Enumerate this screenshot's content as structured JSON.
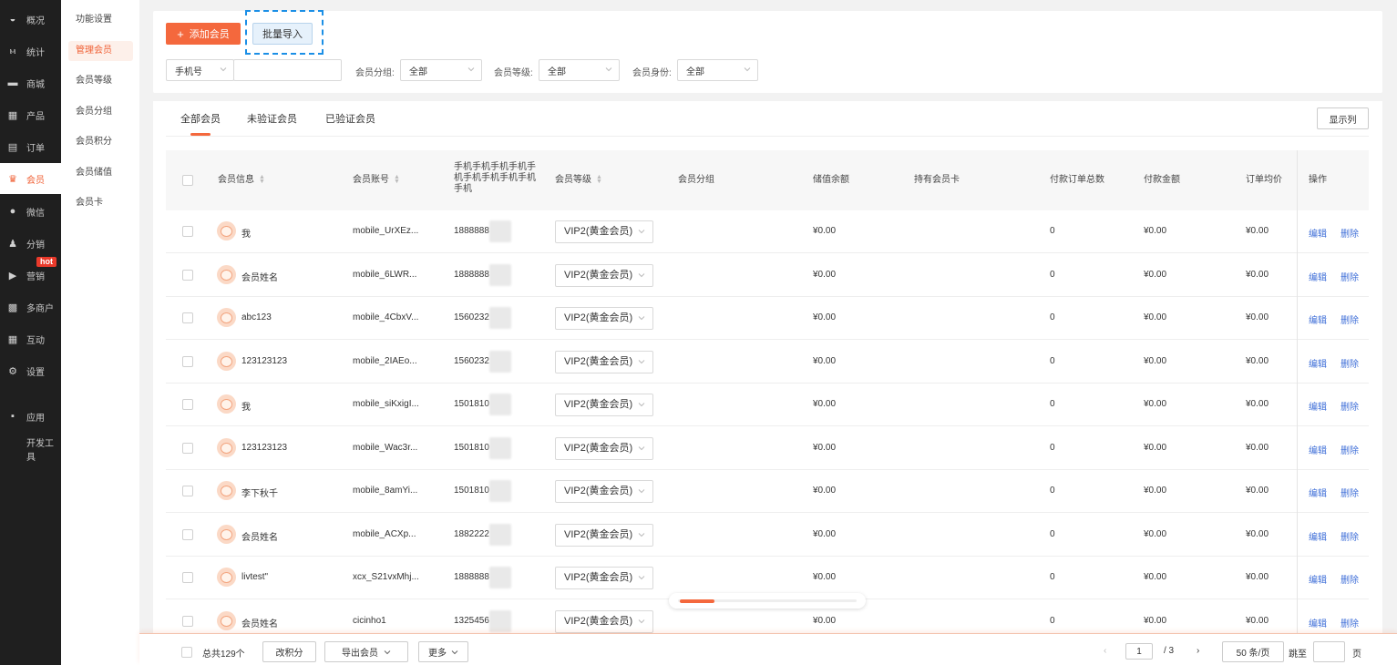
{
  "sidebar": {
    "items": [
      {
        "label": "概况",
        "icon": "overview-icon",
        "glyph": "◒"
      },
      {
        "label": "统计",
        "icon": "stats-icon",
        "glyph": "ⲙ"
      },
      {
        "label": "商城",
        "icon": "shop-icon",
        "glyph": "▬"
      },
      {
        "label": "产品",
        "icon": "product-icon",
        "glyph": "▦"
      },
      {
        "label": "订单",
        "icon": "order-icon",
        "glyph": "▤"
      },
      {
        "label": "会员",
        "icon": "crown-icon",
        "glyph": "♛"
      },
      {
        "label": "微信",
        "icon": "wechat-icon",
        "glyph": "●"
      },
      {
        "label": "分销",
        "icon": "distribution-icon",
        "glyph": "♟"
      },
      {
        "label": "营销",
        "icon": "marketing-icon",
        "glyph": "▶"
      },
      {
        "label": "多商户",
        "icon": "merchant-icon",
        "glyph": "▩"
      },
      {
        "label": "互动",
        "icon": "interact-icon",
        "glyph": "▦"
      },
      {
        "label": "设置",
        "icon": "settings-icon",
        "glyph": "⚙"
      },
      {
        "label": "应用",
        "icon": "apps-icon",
        "glyph": "▪"
      },
      {
        "label": "开发工具",
        "icon": "",
        "glyph": ""
      }
    ],
    "hot_badge": "hot"
  },
  "submenu": {
    "items": [
      "功能设置",
      "管理会员",
      "会员等级",
      "会员分组",
      "会员积分",
      "会员储值",
      "会员卡"
    ]
  },
  "toolbar": {
    "add_label": "添加会员",
    "import_label": "批量导入"
  },
  "filters": {
    "phone_type": "手机号",
    "phone_value": "",
    "group_label": "会员分组:",
    "group_value": "全部",
    "level_label": "会员等级:",
    "level_value": "全部",
    "identity_label": "会员身份:",
    "identity_value": "全部"
  },
  "tabs": [
    "全部会员",
    "未验证会员",
    "已验证会员"
  ],
  "columns_button": "显示列",
  "table": {
    "headers": [
      "会员信息",
      "会员账号",
      "手机手机手机手机手机手机手机手机手机手机",
      "会员等级",
      "会员分组",
      "储值余额",
      "持有会员卡",
      "付款订单总数",
      "付款金额",
      "订单均价",
      "操作"
    ],
    "rows": [
      {
        "name": "我",
        "account": "mobile_UrXEz...",
        "phone": "1888888",
        "level": "VIP2(黄金会员)",
        "balance": "¥0.00",
        "orders": "0",
        "paid": "¥0.00",
        "avg": "¥0.00"
      },
      {
        "name": "会员姓名",
        "account": "mobile_6LWR...",
        "phone": "1888888",
        "level": "VIP2(黄金会员)",
        "balance": "¥0.00",
        "orders": "0",
        "paid": "¥0.00",
        "avg": "¥0.00"
      },
      {
        "name": "abc123",
        "account": "mobile_4CbxV...",
        "phone": "1560232",
        "level": "VIP2(黄金会员)",
        "balance": "¥0.00",
        "orders": "0",
        "paid": "¥0.00",
        "avg": "¥0.00"
      },
      {
        "name": "123123123",
        "account": "mobile_2IAEo...",
        "phone": "1560232",
        "level": "VIP2(黄金会员)",
        "balance": "¥0.00",
        "orders": "0",
        "paid": "¥0.00",
        "avg": "¥0.00"
      },
      {
        "name": "我",
        "account": "mobile_siKxigI...",
        "phone": "1501810",
        "level": "VIP2(黄金会员)",
        "balance": "¥0.00",
        "orders": "0",
        "paid": "¥0.00",
        "avg": "¥0.00"
      },
      {
        "name": "123123123",
        "account": "mobile_Wac3r...",
        "phone": "1501810",
        "level": "VIP2(黄金会员)",
        "balance": "¥0.00",
        "orders": "0",
        "paid": "¥0.00",
        "avg": "¥0.00"
      },
      {
        "name": "李下秋千",
        "account": "mobile_8amYi...",
        "phone": "1501810",
        "level": "VIP2(黄金会员)",
        "balance": "¥0.00",
        "orders": "0",
        "paid": "¥0.00",
        "avg": "¥0.00"
      },
      {
        "name": "会员姓名",
        "account": "mobile_ACXp...",
        "phone": "1882222",
        "level": "VIP2(黄金会员)",
        "balance": "¥0.00",
        "orders": "0",
        "paid": "¥0.00",
        "avg": "¥0.00"
      },
      {
        "name": "livtest\"",
        "account": "xcx_S21vxMhj...",
        "phone": "1888888",
        "level": "VIP2(黄金会员)",
        "balance": "¥0.00",
        "orders": "0",
        "paid": "¥0.00",
        "avg": "¥0.00"
      },
      {
        "name": "会员姓名",
        "account": "cicinho1",
        "phone": "1325456",
        "level": "VIP2(黄金会员)",
        "balance": "¥0.00",
        "orders": "0",
        "paid": "¥0.00",
        "avg": "¥0.00"
      }
    ],
    "edit_label": "编辑",
    "delete_label": "删除"
  },
  "footer": {
    "total": "总共129个",
    "points_btn": "改积分",
    "export_btn": "导出会员",
    "more_btn": "更多",
    "page_current": "1",
    "page_total": "/ 3",
    "page_size": "50 条/页",
    "jump_label": "跳至",
    "page_unit": "页"
  },
  "colors": {
    "accent": "#f4683d",
    "link": "#3f6fd8",
    "sidebar_bg": "#1f1f1f"
  }
}
